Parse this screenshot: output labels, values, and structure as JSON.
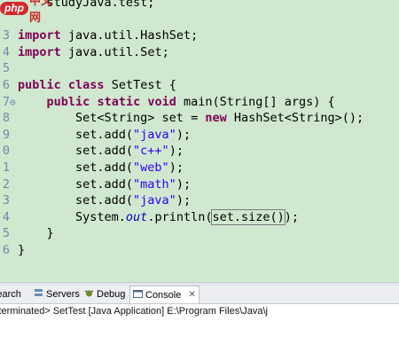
{
  "watermark_logo": {
    "badge": "php",
    "text": "中文网"
  },
  "editor": {
    "lines": [
      {
        "num": "",
        "mark": "",
        "text": "    studyJava.test;"
      },
      {
        "num": "",
        "mark": "",
        "text": ""
      },
      {
        "num": "3",
        "mark": "",
        "text": "import java.util.HashSet;"
      },
      {
        "num": "4",
        "mark": "",
        "text": "import java.util.Set;"
      },
      {
        "num": "5",
        "mark": "",
        "text": ""
      },
      {
        "num": "6",
        "mark": "",
        "text": "public class SetTest {"
      },
      {
        "num": "7",
        "mark": "⊖",
        "text": "    public static void main(String[] args) {"
      },
      {
        "num": "8",
        "mark": "",
        "text": "        Set<String> set = new HashSet<String>();"
      },
      {
        "num": "9",
        "mark": "",
        "text": "        set.add(\"java\");"
      },
      {
        "num": "0",
        "mark": "",
        "text": "        set.add(\"c++\");"
      },
      {
        "num": "1",
        "mark": "",
        "text": "        set.add(\"web\");"
      },
      {
        "num": "2",
        "mark": "",
        "text": "        set.add(\"math\");"
      },
      {
        "num": "3",
        "mark": "",
        "text": "        set.add(\"java\");"
      },
      {
        "num": "4",
        "mark": "",
        "text": "        System.out.println(set.size());"
      },
      {
        "num": "5",
        "mark": "",
        "text": "    }"
      },
      {
        "num": "6",
        "mark": "",
        "text": "}"
      },
      {
        "num": "",
        "mark": "",
        "text": ""
      }
    ]
  },
  "console_panel": {
    "tabs": [
      {
        "label": "Search",
        "icon": "search-icon"
      },
      {
        "label": "Servers",
        "icon": "servers-icon"
      },
      {
        "label": "Debug",
        "icon": "debug-icon"
      },
      {
        "label": "Console",
        "icon": "console-icon",
        "active": true
      }
    ],
    "close_glyph": "✕",
    "status": "<terminated> SetTest [Java Application] E:\\Program Files\\Java\\j"
  },
  "colors": {
    "editor_bg": "#cfe8cf",
    "keyword": "#7f0055",
    "string": "#2a00ff",
    "static_field": "#0000c0",
    "line_number": "#6c8ca8"
  }
}
